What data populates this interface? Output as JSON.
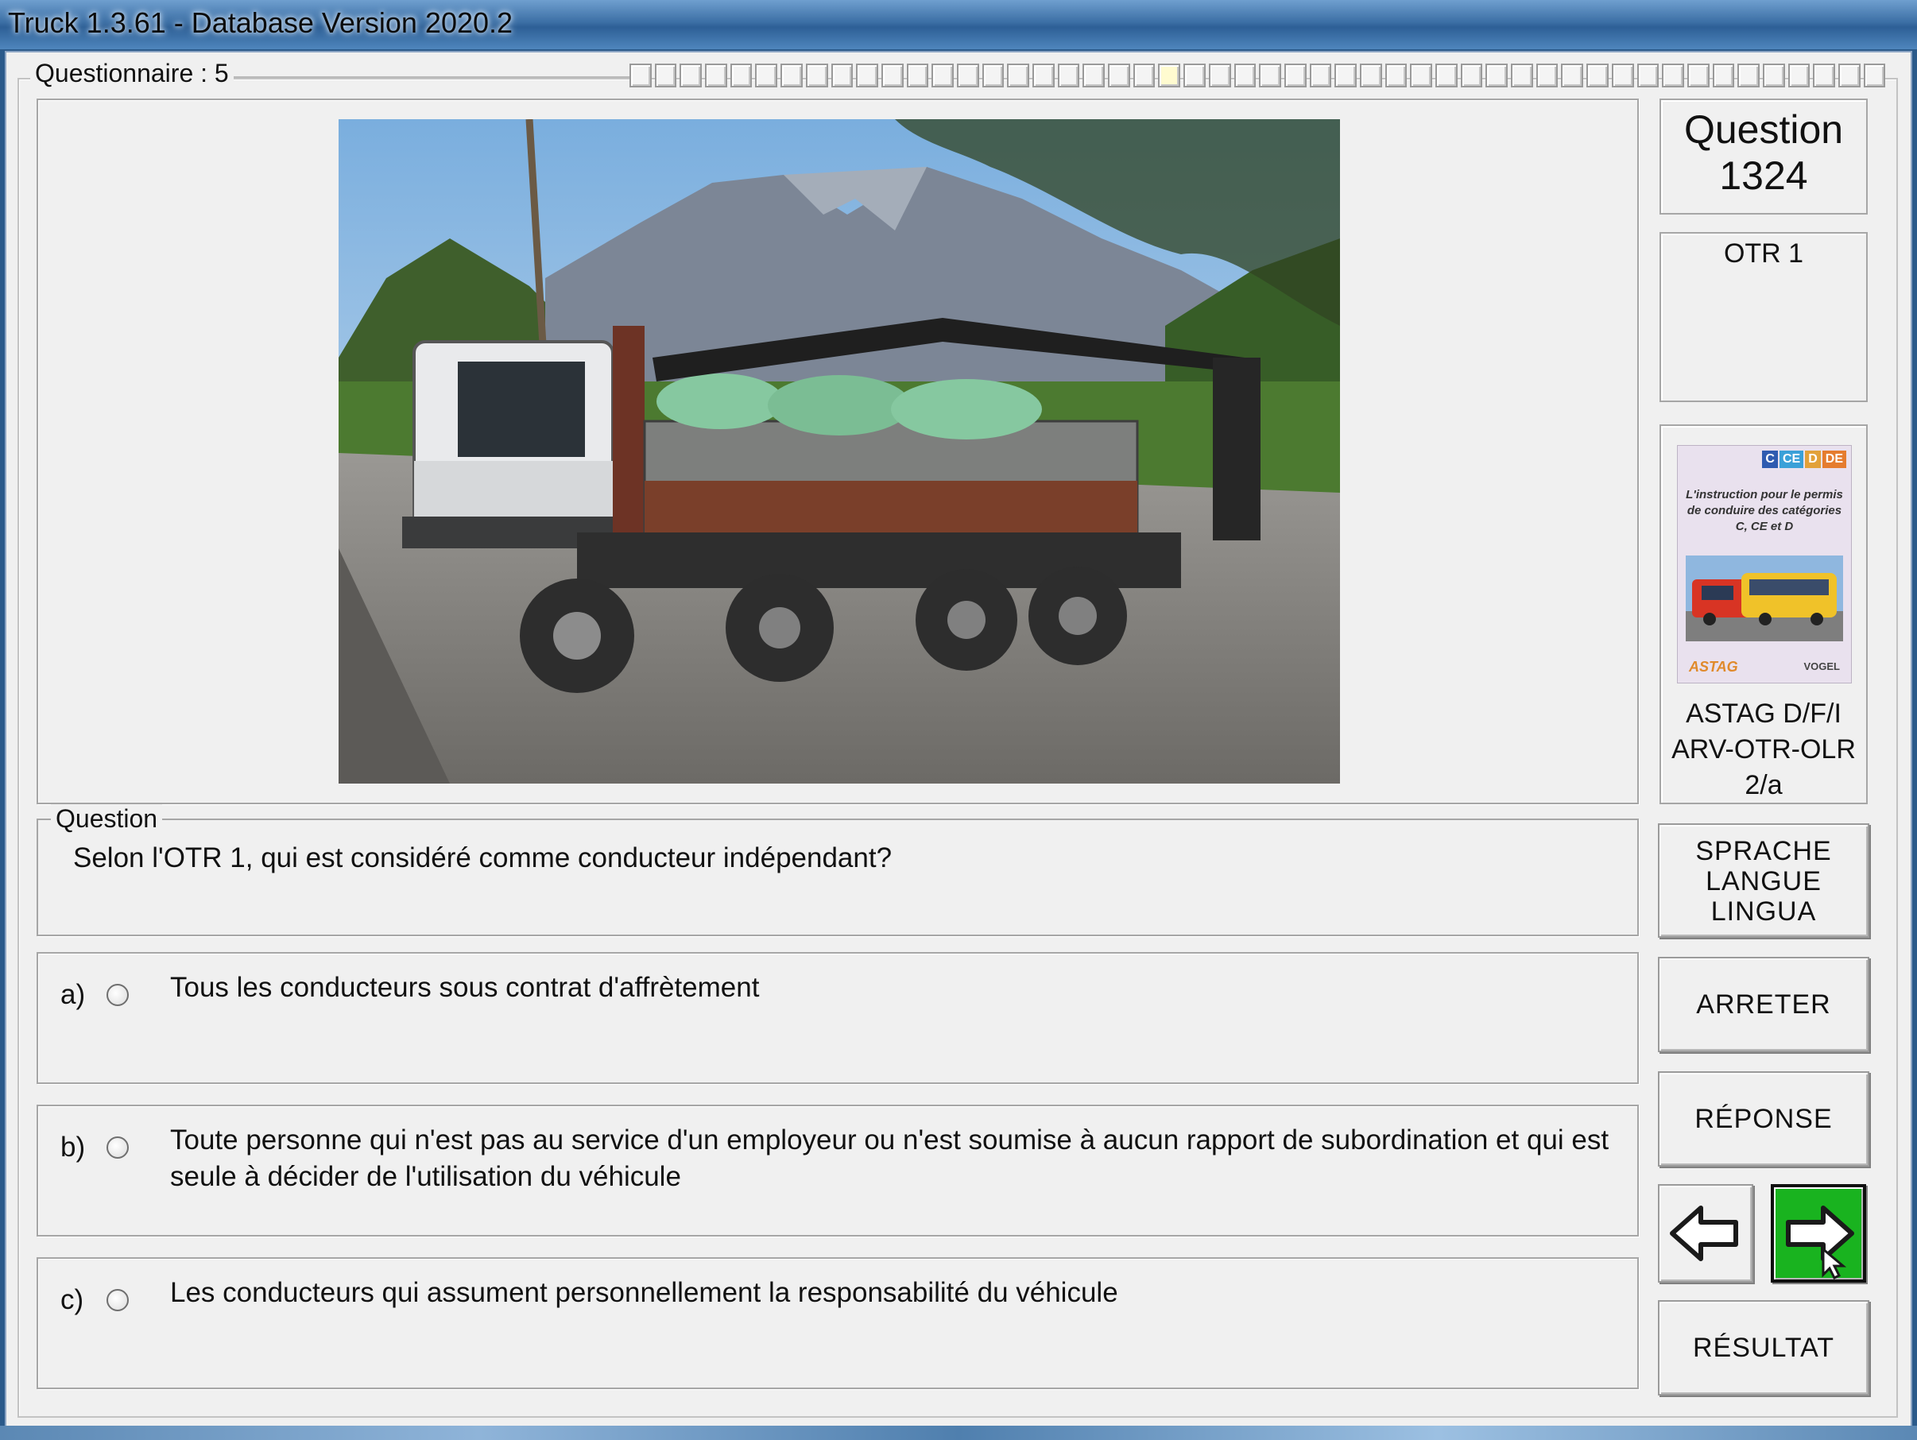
{
  "window": {
    "title": "Truck 1.3.61 - Database Version 2020.2"
  },
  "quiz": {
    "group_label": "Questionnaire : 5",
    "progress": {
      "total_cells": 50,
      "current_cell": 21
    },
    "image_alt": "Camion basculant avec grue de chargement sur route de montagne",
    "question_label": "Question",
    "question_text": "Selon l'OTR 1, qui est considéré comme conducteur indépendant?",
    "answers": [
      {
        "letter": "a)",
        "text": "Tous les conducteurs sous contrat d'affrètement"
      },
      {
        "letter": "b)",
        "text": "Toute personne qui n'est pas au service d'un employeur ou n'est soumise à aucun rapport de subordination et qui est seule à décider de l'utilisation du véhicule"
      },
      {
        "letter": "c)",
        "text": "Les conducteurs qui assument personnellement la responsabilité du véhicule"
      }
    ]
  },
  "side": {
    "question_heading": "Question",
    "question_number": "1324",
    "category": "OTR 1",
    "book": {
      "tags": [
        "C",
        "CE",
        "D",
        "DE"
      ],
      "cover_text": "L'instruction pour le permis de conduire des catégories C, CE et D",
      "logo_left": "ASTAG",
      "logo_right": "VOGEL",
      "line1": "ASTAG D/F/I",
      "line2": "ARV-OTR-OLR",
      "line3": "2/a"
    },
    "buttons": {
      "language": [
        "SPRACHE",
        "LANGUE",
        "LINGUA"
      ],
      "stop": "ARRETER",
      "answer": "RÉPONSE",
      "result": "RÉSULTAT"
    }
  },
  "colors": {
    "next_button": "#19b31f",
    "title_bar": "#3c6fa5"
  }
}
